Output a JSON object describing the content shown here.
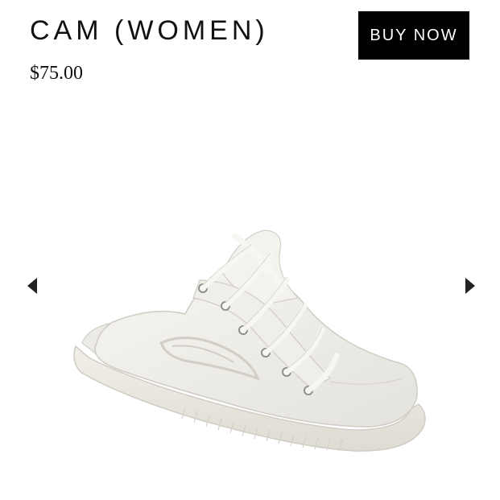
{
  "product": {
    "title": "CAM (WOMEN)",
    "price": "$75.00"
  },
  "actions": {
    "buy_label": "BUY NOW"
  },
  "gallery": {
    "prev_icon": "triangle-left",
    "next_icon": "triangle-right",
    "image": "white-slip-on-sneaker"
  },
  "colors": {
    "button_background": "#000000",
    "button_text": "#ffffff",
    "text": "#111111"
  }
}
